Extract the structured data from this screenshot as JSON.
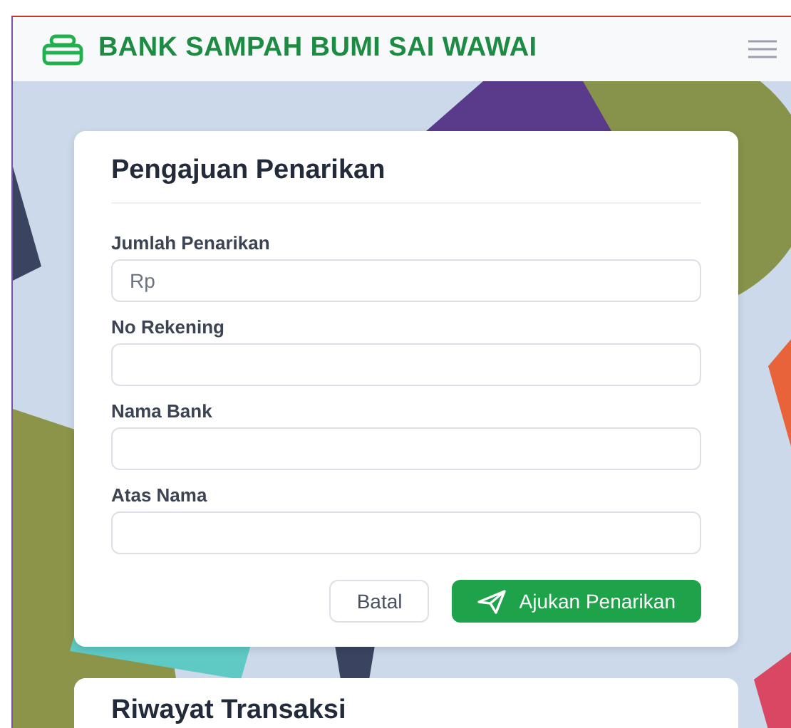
{
  "navbar": {
    "brand": "BANK SAMPAH BUMI SAI WAWAI"
  },
  "withdrawal_form": {
    "title": "Pengajuan Penarikan",
    "fields": [
      {
        "label": "Jumlah Penarikan",
        "placeholder": "Rp"
      },
      {
        "label": "No Rekening"
      },
      {
        "label": "Nama Bank"
      },
      {
        "label": "Atas Nama"
      }
    ],
    "buttons": [
      {
        "label": "Batal",
        "kind": "cancel"
      },
      {
        "label": "Ajukan Penarikan",
        "kind": "submit"
      }
    ]
  },
  "history": {
    "title": "Riwayat Transaksi"
  }
}
